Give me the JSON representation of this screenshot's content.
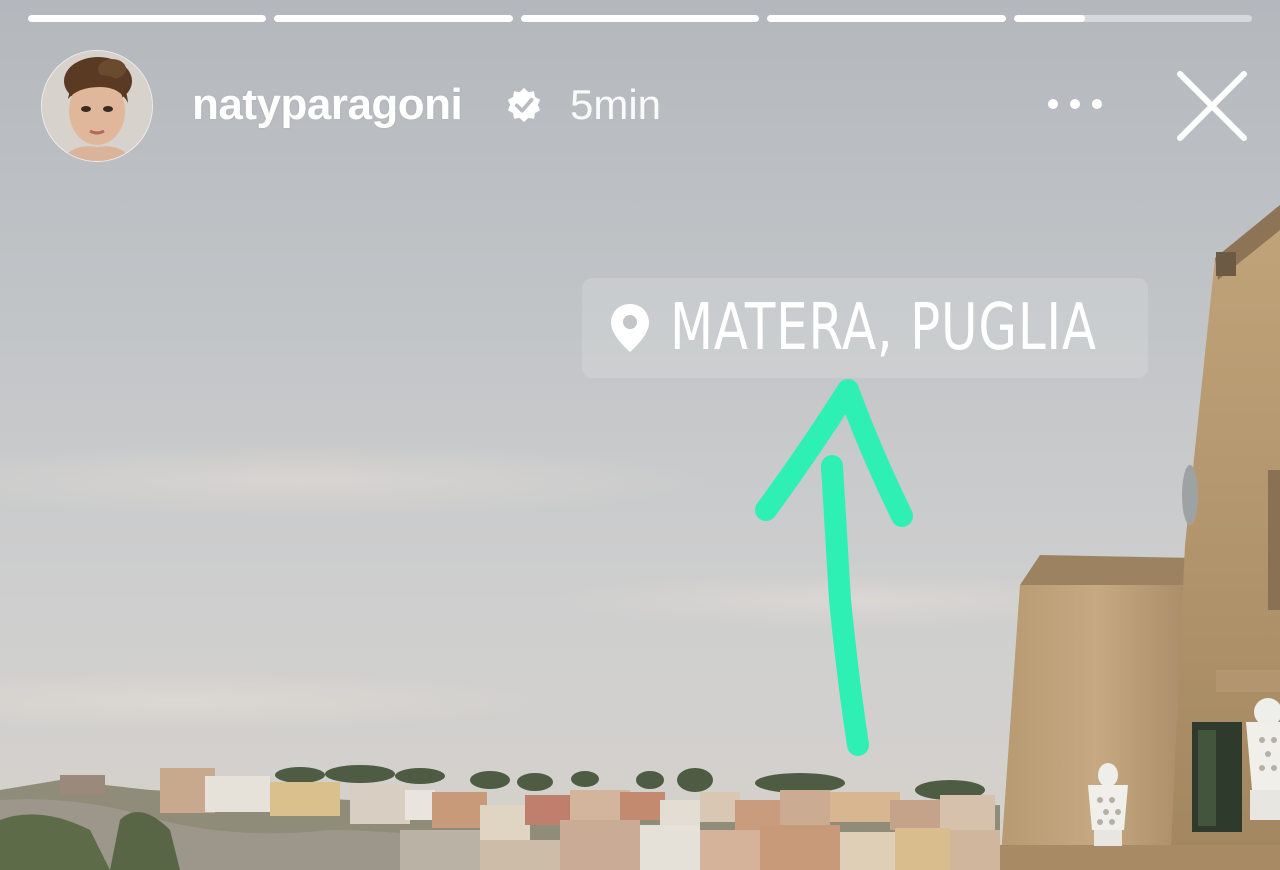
{
  "story": {
    "progress": [
      1,
      1,
      1,
      1,
      0.3
    ],
    "user": {
      "username": "natyparagoni",
      "verified": true,
      "timestamp": "5min",
      "avatar_icon": "profile-photo-avatar"
    },
    "actions": {
      "more_icon": "more-horizontal-icon",
      "close_icon": "close-icon"
    },
    "location_sticker": {
      "icon": "map-pin-icon",
      "text": "MATERA, PUGLIA"
    },
    "drawing": {
      "type": "arrow",
      "color": "#2ef0b4"
    }
  }
}
